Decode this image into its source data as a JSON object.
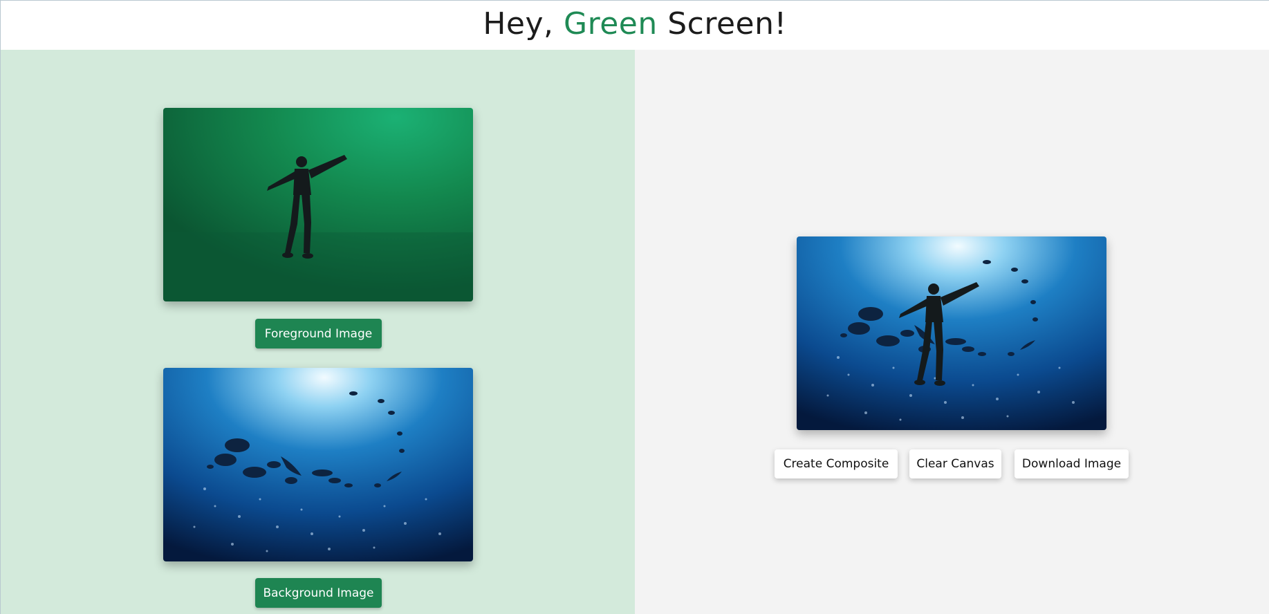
{
  "header": {
    "title_prefix": "Hey, ",
    "title_accent": "Green",
    "title_suffix": " Screen!",
    "accent_color": "#1f8a55"
  },
  "left": {
    "foreground_button": "Foreground Image",
    "background_button": "Background Image",
    "panel_color": "#d3eadb",
    "button_color": "#1e8552"
  },
  "right": {
    "create_button": "Create Composite",
    "clear_button": "Clear Canvas",
    "download_button": "Download Image",
    "panel_color": "#f3f3f3"
  }
}
